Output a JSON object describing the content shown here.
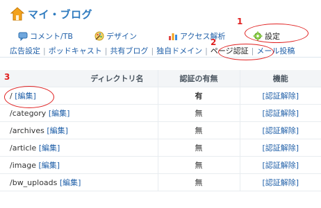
{
  "app": {
    "title": "マイ・ブログ"
  },
  "tabs": [
    {
      "label": "コメント/TB",
      "icon": "comment-icon"
    },
    {
      "label": "デザイン",
      "icon": "palette-icon"
    },
    {
      "label": "アクセス解析",
      "icon": "bar-chart-icon"
    },
    {
      "label": "設定",
      "icon": "settings-icon"
    }
  ],
  "subnav": [
    {
      "label": "広告設定"
    },
    {
      "label": "ポッドキャスト"
    },
    {
      "label": "共有ブログ"
    },
    {
      "label": "独自ドメイン"
    },
    {
      "label": "ページ認証"
    },
    {
      "label": "メール投稿"
    }
  ],
  "annotations": [
    "1",
    "2",
    "3"
  ],
  "table": {
    "headers": [
      "ディレクトリ名",
      "認証の有無",
      "機能"
    ],
    "edit_label": "[編集]",
    "rows": [
      {
        "dir": "/",
        "auth": "有",
        "action": "[認証解除]"
      },
      {
        "dir": "/category",
        "auth": "無",
        "action": "[認証解除]"
      },
      {
        "dir": "/archives",
        "auth": "無",
        "action": "[認証解除]"
      },
      {
        "dir": "/article",
        "auth": "無",
        "action": "[認証解除]"
      },
      {
        "dir": "/image",
        "auth": "無",
        "action": "[認証解除]"
      },
      {
        "dir": "/bw_uploads",
        "auth": "無",
        "action": "[認証解除]"
      }
    ]
  },
  "colors": {
    "accent": "#2f7bbf",
    "link": "#1f5fa8",
    "annotation": "#e02020"
  }
}
